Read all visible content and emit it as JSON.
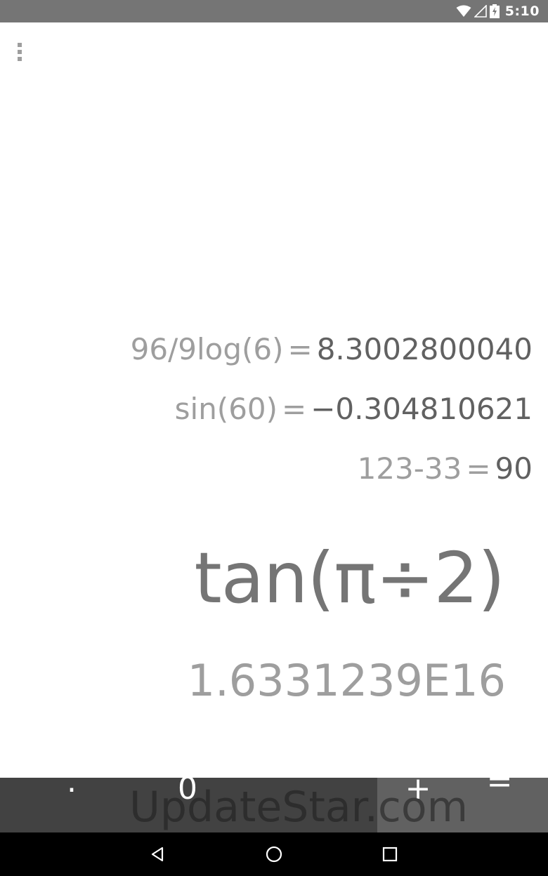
{
  "status_bar": {
    "time": "5:10",
    "icons": [
      "wifi-icon",
      "signal-icon",
      "battery-charging-icon"
    ]
  },
  "menu": {
    "icon": "more-vert-icon"
  },
  "history": [
    {
      "expression": "96/9log(6)",
      "equals": "=",
      "result": "8.3002800040"
    },
    {
      "expression": "sin(60)",
      "equals": "=",
      "result": "−0.304810621"
    },
    {
      "expression": "123-33",
      "equals": "=",
      "result": "90"
    }
  ],
  "display": {
    "formula": "tan(π÷2)",
    "result": "1.6331239E16"
  },
  "keypad": {
    "keys": [
      ".",
      "0",
      "+",
      "="
    ]
  },
  "watermark": "UpdateStar.com",
  "nav_bar": {
    "icons": [
      "back-icon",
      "home-icon",
      "recents-icon"
    ]
  }
}
